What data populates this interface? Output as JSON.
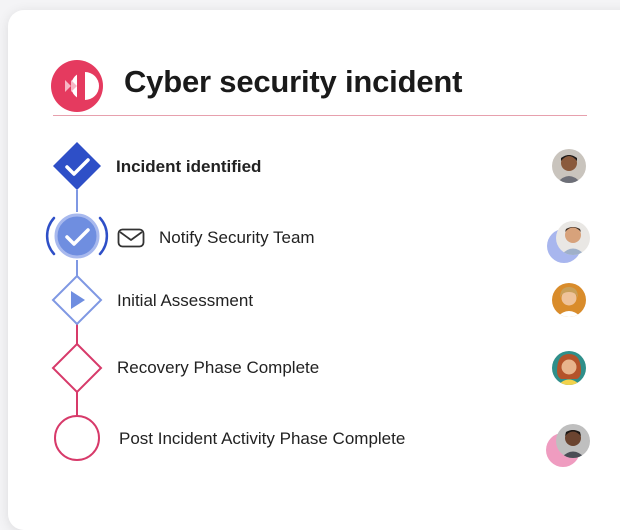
{
  "header": {
    "title": "Cyber security incident",
    "logo_icon": "fast-forward-icon"
  },
  "steps": [
    {
      "label": "Incident identified",
      "status": "completed",
      "icon": "check-diamond-icon"
    },
    {
      "label": "Notify Security Team",
      "status": "completed-active",
      "icon": "check-circle-icon",
      "prefix_icon": "mail-icon"
    },
    {
      "label": "Initial Assessment",
      "status": "in-progress",
      "icon": "play-diamond-icon"
    },
    {
      "label": "Recovery Phase Complete",
      "status": "pending",
      "icon": "diamond-outline-icon"
    },
    {
      "label": "Post Incident Activity Phase Complete",
      "status": "pending",
      "icon": "circle-outline-icon"
    }
  ],
  "colors": {
    "brand": "#e53a5f",
    "primary_blue": "#2e4fc7",
    "light_blue": "#6f8ee0",
    "pink": "#d73a6a",
    "divider": "#e7a0ad"
  }
}
